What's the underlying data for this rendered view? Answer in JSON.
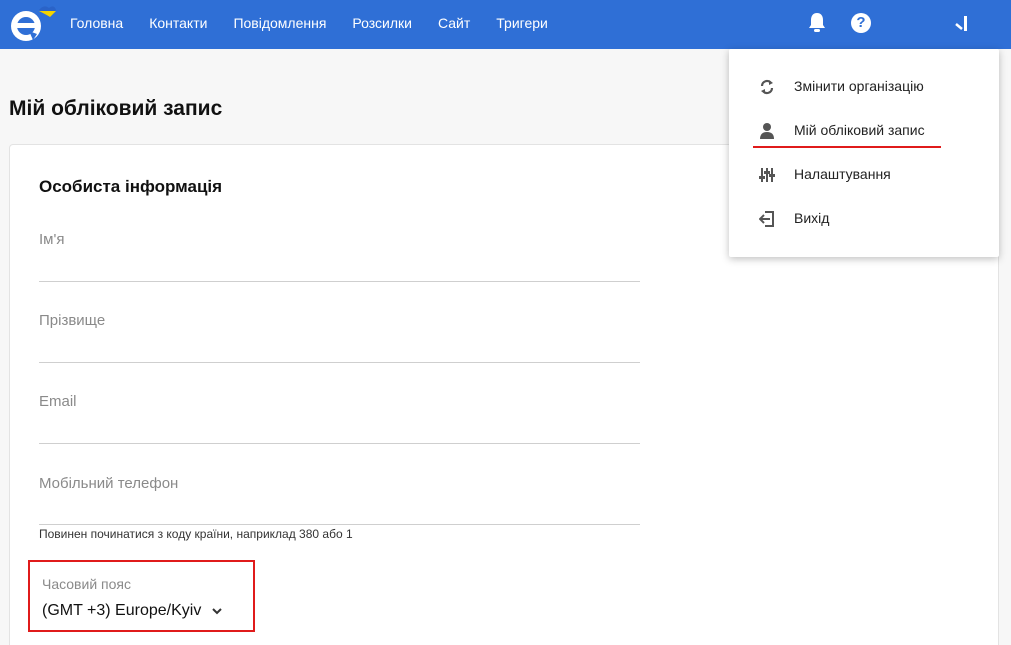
{
  "header": {
    "nav": [
      "Головна",
      "Контакти",
      "Повідомлення",
      "Розсилки",
      "Сайт",
      "Тригери"
    ],
    "help_label": "?"
  },
  "page": {
    "title": "Мій обліковий запис"
  },
  "personal": {
    "section_title": "Особиста інформація",
    "fields": [
      {
        "label": "Ім'я",
        "value": ""
      },
      {
        "label": "Прізвище",
        "value": ""
      },
      {
        "label": "Email",
        "value": ""
      },
      {
        "label": "Мобільний телефон",
        "value": ""
      }
    ],
    "phone_helper": "Повинен починатися з коду країни, наприклад 380 або 1",
    "timezone_label": "Часовий пояс",
    "timezone_value": "(GMT +3) Europe/Kyiv"
  },
  "dropdown": {
    "items": [
      {
        "label": "Змінити організацію",
        "icon": "refresh-icon"
      },
      {
        "label": "Мій обліковий запис",
        "icon": "user-icon"
      },
      {
        "label": "Налаштування",
        "icon": "sliders-icon"
      },
      {
        "label": "Вихід",
        "icon": "logout-icon"
      }
    ]
  },
  "colors": {
    "header_bg": "#2f6fd6",
    "highlight": "#e01b1b",
    "flag_blue": "#2a63c8",
    "flag_yellow": "#f5d400"
  }
}
